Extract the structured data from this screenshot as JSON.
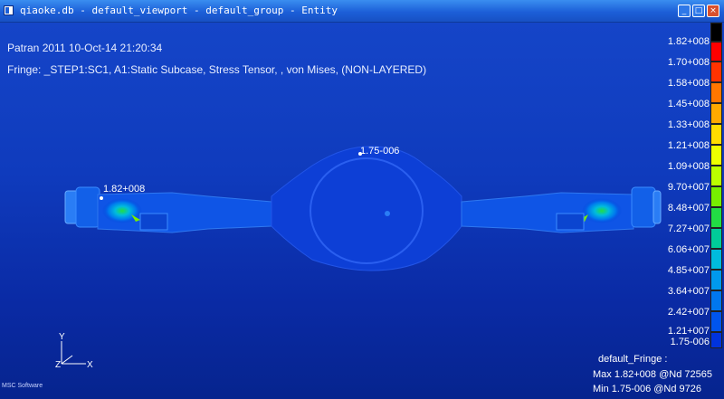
{
  "window": {
    "title": "qiaoke.db - default_viewport - default_group - Entity",
    "icon": "app-window-icon",
    "controls": {
      "minimize": "_",
      "maximize": "□",
      "close": "×"
    }
  },
  "viewport": {
    "header_line1": "Patran 2011 10-Oct-14 21:20:34",
    "header_line2": "Fringe: _STEP1:SC1, A1:Static Subcase, Stress Tensor, , von Mises, (NON-LAYERED)",
    "probe_max": "1.82+008",
    "probe_min": "1.75-006"
  },
  "legend": {
    "entries": [
      {
        "label": "1.82+008",
        "color": "#ff0000"
      },
      {
        "label": "1.70+008",
        "color": "#ff3300"
      },
      {
        "label": "1.58+008",
        "color": "#ff7700"
      },
      {
        "label": "1.45+008",
        "color": "#ffaa00"
      },
      {
        "label": "1.33+008",
        "color": "#ffdd00"
      },
      {
        "label": "1.21+008",
        "color": "#eeff00"
      },
      {
        "label": "1.09+008",
        "color": "#bbff00"
      },
      {
        "label": "9.70+007",
        "color": "#77ee00"
      },
      {
        "label": "8.48+007",
        "color": "#22dd44"
      },
      {
        "label": "7.27+007",
        "color": "#00cc99"
      },
      {
        "label": "6.06+007",
        "color": "#00bbdd"
      },
      {
        "label": "4.85+007",
        "color": "#0099ee"
      },
      {
        "label": "3.64+007",
        "color": "#0077ee"
      },
      {
        "label": "2.42+007",
        "color": "#0055ee"
      },
      {
        "label": "1.21+007",
        "color": "#0033dd"
      }
    ],
    "bottom_label": "1.75-006",
    "top_color": "#000000"
  },
  "axes": {
    "y": "Y",
    "z": "Z",
    "x": "X"
  },
  "summary": {
    "title": "default_Fringe :",
    "max": "Max 1.82+008 @Nd 72565",
    "min": "Min 1.75-006 @Nd 9726"
  },
  "logo": "MSC Software"
}
